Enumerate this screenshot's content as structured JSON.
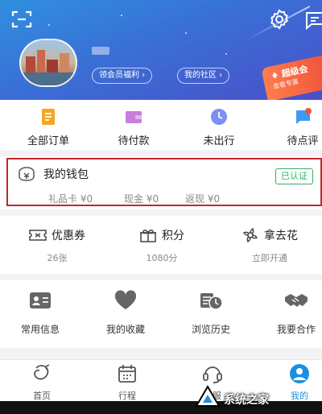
{
  "header": {
    "pill_member": "领会员福利 ›",
    "pill_community": "我的社区 ›",
    "vip_title": "超级会",
    "vip_sub": "查看专属"
  },
  "orders": [
    {
      "label": "全部订单",
      "icon": "list-icon",
      "color": "#f5a623"
    },
    {
      "label": "待付款",
      "icon": "wallet-card-icon",
      "color": "#c77ddd"
    },
    {
      "label": "未出行",
      "icon": "clock-icon",
      "color": "#7d8ff0"
    },
    {
      "label": "待点评",
      "icon": "comment-icon",
      "color": "#3d9cf2"
    }
  ],
  "wallet": {
    "title": "我的钱包",
    "certified": "已认证",
    "gift_card": "礼品卡 ¥0",
    "cash": "现金 ¥0",
    "cashback": "返现 ¥0"
  },
  "assets": [
    {
      "label": "优惠券",
      "value": "26张",
      "icon": "coupon-icon"
    },
    {
      "label": "积分",
      "value": "1080分",
      "icon": "gift-icon"
    },
    {
      "label": "拿去花",
      "value": "立即开通",
      "icon": "flower-icon"
    }
  ],
  "tools": [
    {
      "label": "常用信息",
      "icon": "id-card-icon"
    },
    {
      "label": "我的收藏",
      "icon": "heart-icon"
    },
    {
      "label": "浏览历史",
      "icon": "history-icon"
    },
    {
      "label": "我要合作",
      "icon": "handshake-icon"
    }
  ],
  "tabbar": [
    {
      "label": "首页",
      "icon": "home-icon",
      "active": false
    },
    {
      "label": "行程",
      "icon": "calendar-icon",
      "active": false
    },
    {
      "label": "客服",
      "icon": "headset-icon",
      "active": false
    },
    {
      "label": "我的",
      "icon": "user-icon",
      "active": true
    }
  ],
  "watermark": "系统之家",
  "colors": {
    "primary": "#1e8fe0",
    "highlight_border": "#c0272d",
    "certified": "#2fb36b"
  }
}
